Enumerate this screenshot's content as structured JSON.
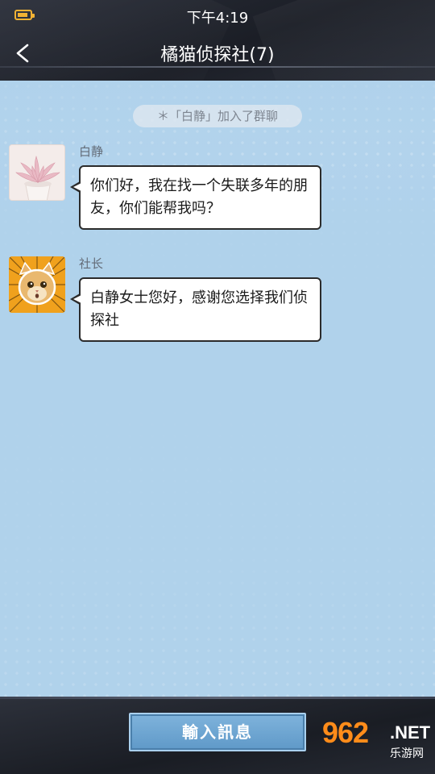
{
  "status_bar": {
    "time": "下午4:19",
    "battery_icon": "battery-icon"
  },
  "header": {
    "back_icon": "chevron-left-icon",
    "title": "橘猫侦探社(7)"
  },
  "chat": {
    "system_notice": "＊「白静」加入了群聊",
    "messages": [
      {
        "sender": "白静",
        "avatar": "succulent-plant-avatar",
        "text": "你们好，我在找一个失联多年的朋友，你们能帮我吗？"
      },
      {
        "sender": "社长",
        "avatar": "orange-cat-avatar",
        "text": "白静女士您好，感谢您选择我们侦探社"
      }
    ]
  },
  "bottom_bar": {
    "input_button_label": "輸入訊息"
  },
  "watermark": {
    "logo": "962",
    "domain": ".NET",
    "sub": "乐游网"
  },
  "colors": {
    "chat_background": "#b2d3ec",
    "header_background": "#1f2430",
    "bubble_border": "#2b2b2b",
    "button_blue": "#6fa7d3",
    "battery": "#f2b233"
  }
}
